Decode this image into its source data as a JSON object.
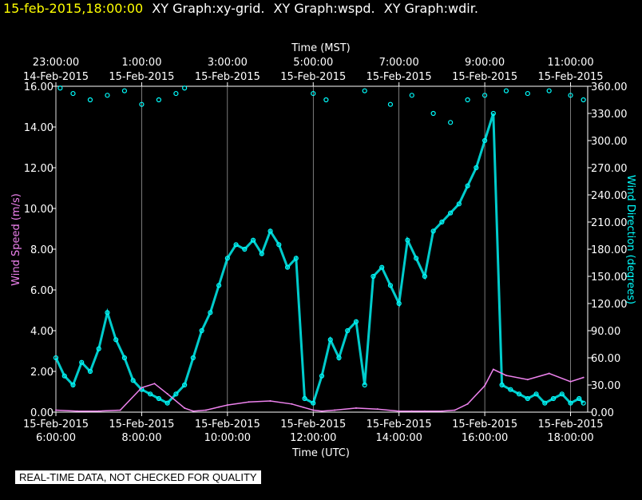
{
  "header": {
    "time": "15-feb-2015,18:00:00",
    "graphs": [
      "XY Graph:xy-grid.",
      "XY Graph:wspd.",
      "XY Graph:wdir."
    ]
  },
  "footer_note": "REAL-TIME DATA, NOT CHECKED FOR QUALITY",
  "colors": {
    "wind_speed": "#ee82ee",
    "wind_direction": "#00ffff",
    "header_time": "#ffff00",
    "axes": "#ffffff",
    "background": "#000000"
  },
  "chart_data": {
    "type": "scatter",
    "top_axis": {
      "title": "Time (MST)",
      "ticks": [
        {
          "hour": 0,
          "time": "23:00:00",
          "date": "14-Feb-2015"
        },
        {
          "hour": 2,
          "time": "1:00:00",
          "date": "15-Feb-2015"
        },
        {
          "hour": 4,
          "time": "3:00:00",
          "date": "15-Feb-2015"
        },
        {
          "hour": 6,
          "time": "5:00:00",
          "date": "15-Feb-2015"
        },
        {
          "hour": 8,
          "time": "7:00:00",
          "date": "15-Feb-2015"
        },
        {
          "hour": 10,
          "time": "9:00:00",
          "date": "15-Feb-2015"
        },
        {
          "hour": 12,
          "time": "11:00:00",
          "date": "15-Feb-2015"
        }
      ]
    },
    "bottom_axis": {
      "title": "Time (UTC)",
      "range_hours": [
        0,
        12.4
      ],
      "ticks": [
        {
          "hour": 0,
          "date": "15-Feb-2015",
          "time": "6:00:00"
        },
        {
          "hour": 2,
          "date": "15-Feb-2015",
          "time": "8:00:00"
        },
        {
          "hour": 4,
          "date": "15-Feb-2015",
          "time": "10:00:00"
        },
        {
          "hour": 6,
          "date": "15-Feb-2015",
          "time": "12:00:00"
        },
        {
          "hour": 8,
          "date": "15-Feb-2015",
          "time": "14:00:00"
        },
        {
          "hour": 10,
          "date": "15-Feb-2015",
          "time": "16:00:00"
        },
        {
          "hour": 12,
          "date": "15-Feb-2015",
          "time": "18:00:00"
        }
      ]
    },
    "left_axis": {
      "title": "Wind Speed (m/s)",
      "range": [
        0,
        16
      ],
      "ticks": [
        "0.00",
        "2.00",
        "4.00",
        "6.00",
        "8.00",
        "10.00",
        "12.00",
        "14.00",
        "16.00"
      ]
    },
    "right_axis": {
      "title": "Wind Direction (degrees)",
      "range": [
        0,
        360
      ],
      "ticks": [
        "0.00",
        "30.00",
        "60.00",
        "90.00",
        "120.00",
        "150.00",
        "180.00",
        "210.00",
        "240.00",
        "270.00",
        "300.00",
        "330.00",
        "360.00"
      ]
    },
    "grid": "vertical lines at each 2-hour tick",
    "series": [
      {
        "key": "wspd",
        "axis": "left",
        "style": "line",
        "x_hours": [
          0,
          0.5,
          1,
          1.5,
          2,
          2.3,
          2.6,
          3,
          3.2,
          3.5,
          3.8,
          4,
          4.5,
          5,
          5.5,
          6,
          6.2,
          6.5,
          7,
          7.5,
          8,
          8.3,
          8.6,
          9,
          9.3,
          9.6,
          10,
          10.2,
          10.5,
          11,
          11.5,
          12,
          12.3
        ],
        "values": [
          0.1,
          0.05,
          0.05,
          0.1,
          1.2,
          1.4,
          0.9,
          0.2,
          0.05,
          0.1,
          0.25,
          0.35,
          0.5,
          0.55,
          0.4,
          0.1,
          0.05,
          0.1,
          0.2,
          0.15,
          0.05,
          0.05,
          0.05,
          0.05,
          0.1,
          0.4,
          1.3,
          2.1,
          1.8,
          1.6,
          1.9,
          1.5,
          1.7
        ]
      },
      {
        "key": "wdir",
        "axis": "right",
        "style": "circles",
        "x_hours": [
          0,
          0.2,
          0.4,
          0.6,
          0.8,
          1,
          1.2,
          1.4,
          1.6,
          1.8,
          2,
          2.2,
          2.4,
          2.6,
          2.8,
          3,
          3.2,
          3.4,
          3.6,
          3.8,
          4,
          4.2,
          4.4,
          4.6,
          4.8,
          5,
          5.2,
          5.4,
          5.6,
          5.8,
          6,
          6.2,
          6.4,
          6.6,
          6.8,
          7,
          7.2,
          7.4,
          7.6,
          7.8,
          8,
          8.2,
          8.4,
          8.6,
          8.8,
          9,
          9.2,
          9.4,
          9.6,
          9.8,
          10,
          10.2,
          10.4,
          10.6,
          10.8,
          11,
          11.2,
          11.4,
          11.6,
          11.8,
          12,
          12.2,
          12.3
        ],
        "values": [
          60,
          40,
          30,
          55,
          45,
          70,
          110,
          80,
          60,
          35,
          25,
          20,
          15,
          10,
          20,
          30,
          60,
          90,
          110,
          140,
          170,
          185,
          180,
          190,
          175,
          200,
          185,
          160,
          170,
          15,
          10,
          40,
          80,
          60,
          90,
          100,
          30,
          150,
          160,
          140,
          120,
          190,
          170,
          150,
          200,
          210,
          220,
          230,
          250,
          270,
          300,
          330,
          30,
          25,
          20,
          15,
          20,
          10,
          15,
          20,
          10,
          15,
          10
        ],
        "scatter_points": [
          [
            0.1,
            358
          ],
          [
            0.4,
            352
          ],
          [
            0.8,
            345
          ],
          [
            1.2,
            350
          ],
          [
            1.6,
            355
          ],
          [
            2.0,
            340
          ],
          [
            2.4,
            345
          ],
          [
            2.8,
            352
          ],
          [
            3.0,
            358
          ],
          [
            6.0,
            352
          ],
          [
            6.3,
            345
          ],
          [
            7.2,
            355
          ],
          [
            7.8,
            340
          ],
          [
            8.3,
            350
          ],
          [
            8.8,
            330
          ],
          [
            9.2,
            320
          ],
          [
            9.6,
            345
          ],
          [
            10.0,
            350
          ],
          [
            10.5,
            355
          ],
          [
            11.0,
            352
          ],
          [
            11.5,
            355
          ],
          [
            12.0,
            350
          ],
          [
            12.3,
            345
          ]
        ]
      }
    ]
  }
}
